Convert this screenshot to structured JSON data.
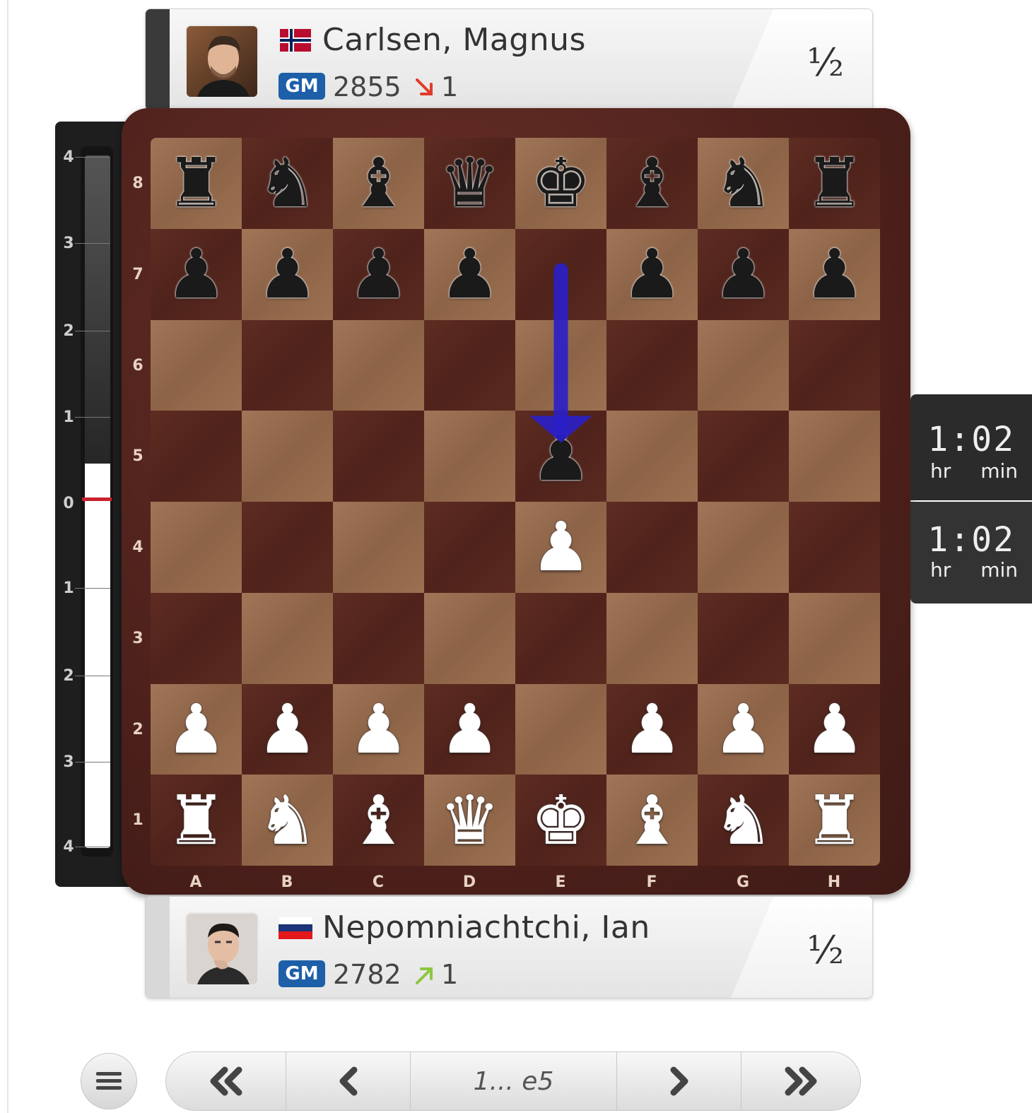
{
  "players": {
    "top": {
      "name": "Carlsen, Magnus",
      "title": "GM",
      "rating": "2855",
      "rating_change": "1",
      "rating_direction": "down",
      "score": "½",
      "flag": "norway-flag",
      "flag_colors": {
        "red": "#ba0c2f",
        "white": "#ffffff",
        "blue": "#00205b"
      }
    },
    "bottom": {
      "name": "Nepomniachtchi, Ian",
      "title": "GM",
      "rating": "2782",
      "rating_change": "1",
      "rating_direction": "up",
      "score": "½",
      "flag": "russia-flag",
      "flag_colors": {
        "white": "#ffffff",
        "blue": "#1c3578",
        "red": "#e4181c"
      }
    }
  },
  "eval_bar": {
    "ticks_top": [
      "4",
      "3",
      "2",
      "1"
    ],
    "center": "0",
    "ticks_bottom": [
      "1",
      "2",
      "3",
      "4"
    ],
    "evaluation": 0.4
  },
  "board": {
    "ranks": [
      "8",
      "7",
      "6",
      "5",
      "4",
      "3",
      "2",
      "1"
    ],
    "files": [
      "A",
      "B",
      "C",
      "D",
      "E",
      "F",
      "G",
      "H"
    ],
    "position": [
      [
        "r",
        "n",
        "b",
        "q",
        "k",
        "b",
        "n",
        "r"
      ],
      [
        "p",
        "p",
        "p",
        "p",
        "",
        "p",
        "p",
        "p"
      ],
      [
        "",
        "",
        "",
        "",
        "",
        "",
        "",
        ""
      ],
      [
        "",
        "",
        "",
        "",
        "p",
        "",
        "",
        ""
      ],
      [
        "",
        "",
        "",
        "",
        "P",
        "",
        "",
        ""
      ],
      [
        "",
        "",
        "",
        "",
        "",
        "",
        "",
        ""
      ],
      [
        "P",
        "P",
        "P",
        "P",
        "",
        "P",
        "P",
        "P"
      ],
      [
        "R",
        "N",
        "B",
        "Q",
        "K",
        "B",
        "N",
        "R"
      ]
    ],
    "last_move_arrow": {
      "from": "e7",
      "to": "e5",
      "color": "#2a1fc9"
    }
  },
  "clocks": {
    "top": {
      "time": "1:02",
      "hr": "hr",
      "min": "min"
    },
    "bottom": {
      "time": "1:02",
      "hr": "hr",
      "min": "min"
    }
  },
  "navigation": {
    "first": "«",
    "prev": "‹",
    "current_move": "1... e5",
    "next": "›",
    "last": "»"
  },
  "colors": {
    "gm_badge": "#1d5fa8",
    "rating_down": "#e03a2a",
    "rating_up": "#8cc63f",
    "eval_marker": "#c8232c"
  }
}
